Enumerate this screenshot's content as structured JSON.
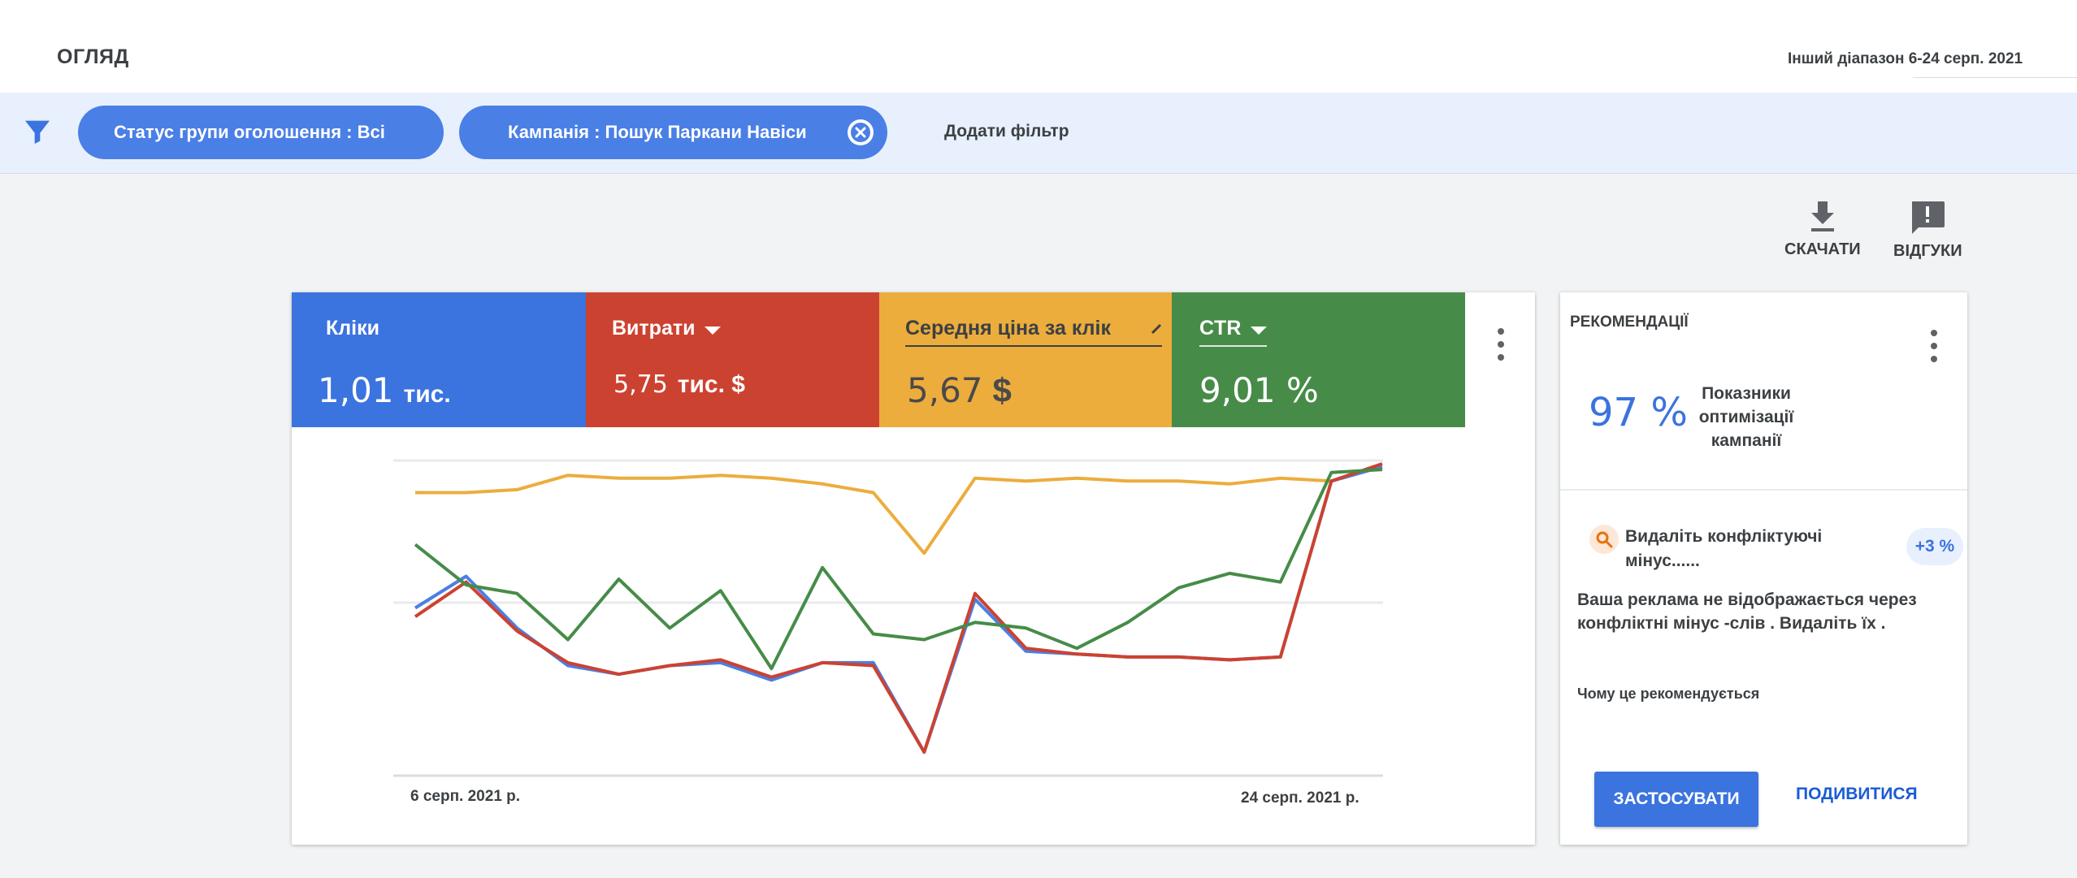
{
  "header": {
    "title": "ОГЛЯД",
    "date_range": "Інший діапазон 6-24 серп. 2021"
  },
  "filters": {
    "icon": "filter-icon",
    "chips": [
      {
        "label": "Статус групи оголошення : Всі"
      },
      {
        "label": "Кампанія : Пошук Паркани Навіси",
        "closable": true
      }
    ],
    "add_filter": "Додати фільтр"
  },
  "actions": {
    "download": "СКАЧАТИ",
    "feedback": "ВІДГУКИ"
  },
  "metrics": {
    "clicks": {
      "label": "Кліки",
      "value": "1,01",
      "unit": "тис.",
      "color": "#3b73df"
    },
    "cost": {
      "label": "Витрати",
      "value": "5,75",
      "unit": "тис. $",
      "color": "#cc4230"
    },
    "cpc": {
      "label": "Середня ціна за клік",
      "value": "5,67",
      "unit": "$",
      "color": "#ecad3d"
    },
    "ctr": {
      "label": "CTR",
      "value": "9,01 %",
      "color": "#468c48"
    }
  },
  "chart_data": {
    "type": "line",
    "x_start_label": "6 серп. 2021 р.",
    "x_end_label": "24 серп. 2021 р.",
    "grid": true,
    "series": [
      {
        "color": "#ecad3d",
        "values": [
          0.9,
          0.9,
          0.91,
          0.96,
          0.95,
          0.95,
          0.96,
          0.95,
          0.93,
          0.9,
          0.69,
          0.95,
          0.94,
          0.95,
          0.94,
          0.94,
          0.93,
          0.95,
          0.94,
          0.99
        ]
      },
      {
        "color": "#4a7fe6",
        "values": [
          0.5,
          0.61,
          0.43,
          0.3,
          0.27,
          0.3,
          0.31,
          0.25,
          0.31,
          0.31,
          0.0,
          0.53,
          0.35,
          0.34,
          0.33,
          0.33,
          0.32,
          0.33,
          0.94,
          0.99
        ]
      },
      {
        "color": "#cc4230",
        "values": [
          0.47,
          0.59,
          0.42,
          0.31,
          0.27,
          0.3,
          0.32,
          0.26,
          0.31,
          0.3,
          0.0,
          0.55,
          0.36,
          0.34,
          0.33,
          0.33,
          0.32,
          0.33,
          0.94,
          1.0
        ]
      },
      {
        "color": "#468c48",
        "values": [
          0.72,
          0.58,
          0.55,
          0.39,
          0.6,
          0.43,
          0.56,
          0.29,
          0.64,
          0.41,
          0.39,
          0.45,
          0.43,
          0.36,
          0.45,
          0.57,
          0.62,
          0.59,
          0.97,
          0.98
        ]
      }
    ]
  },
  "recommendations": {
    "title": "РЕКОМЕНДАЦІЇ",
    "score": "97 %",
    "score_label": "Показники оптимізації кампанії",
    "item": {
      "icon": "search-icon",
      "title": "Видаліть конфліктуючі мінус......",
      "badge": "+3 %",
      "description": "Ваша реклама не відображається  через конфліктні мінус -слів . Видаліть їх .",
      "why": "Чому це рекомендується",
      "apply": "ЗАСТОСУВАТИ",
      "view": "ПОДИВИТИСЯ"
    }
  }
}
